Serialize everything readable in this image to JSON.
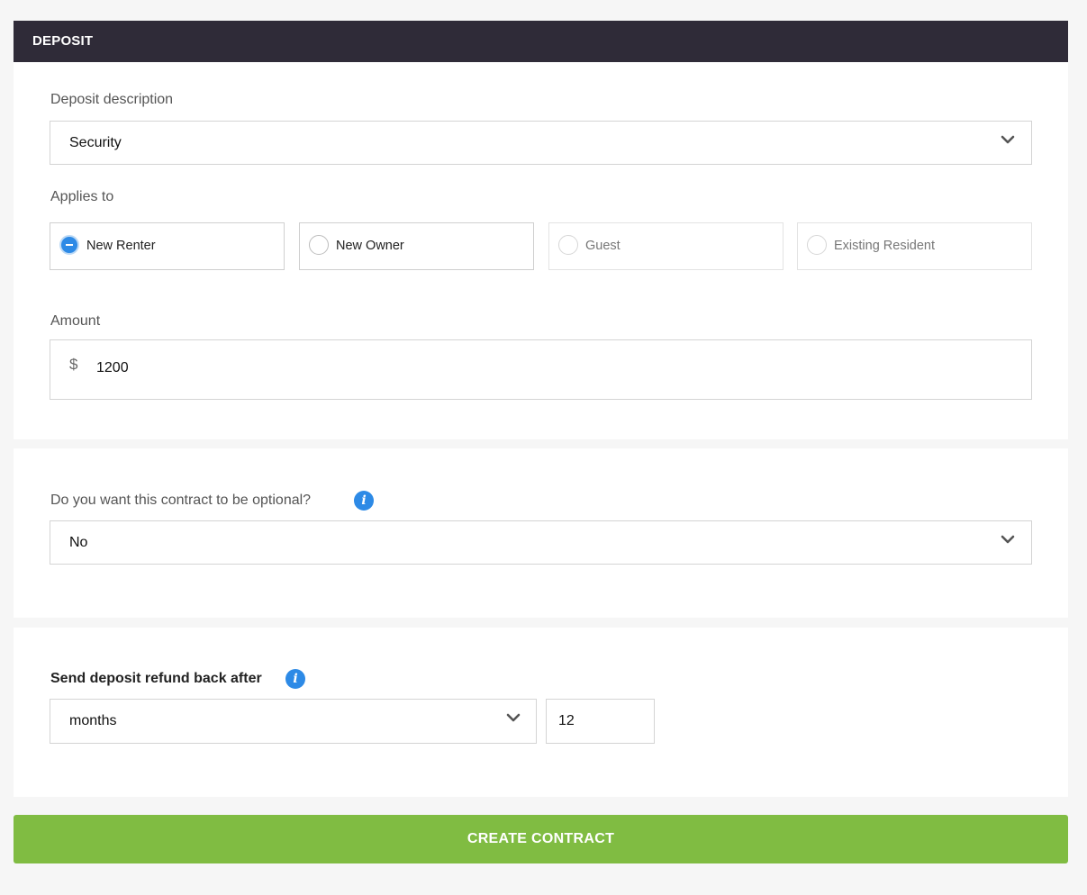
{
  "header": {
    "title": "DEPOSIT"
  },
  "deposit_description": {
    "label": "Deposit description",
    "selected": "Security"
  },
  "applies_to": {
    "label": "Applies to",
    "options": [
      {
        "label": "New Renter",
        "selected": true,
        "disabled": false
      },
      {
        "label": "New Owner",
        "selected": false,
        "disabled": false
      },
      {
        "label": "Guest",
        "selected": false,
        "disabled": true
      },
      {
        "label": "Existing Resident",
        "selected": false,
        "disabled": true
      }
    ]
  },
  "amount": {
    "label": "Amount",
    "currency_symbol": "$",
    "value": "1200"
  },
  "optional": {
    "question": "Do you want this contract to be optional?",
    "info_icon": "info-icon",
    "selected": "No"
  },
  "refund": {
    "label": "Send deposit refund back after",
    "info_icon": "info-icon",
    "unit_selected": "months",
    "count_value": "12"
  },
  "actions": {
    "create_label": "CREATE CONTRACT"
  },
  "colors": {
    "header_bg": "#2f2b38",
    "accent_blue": "#2d8ae6",
    "button_green": "#80bc42",
    "page_bg": "#f6f6f6"
  }
}
